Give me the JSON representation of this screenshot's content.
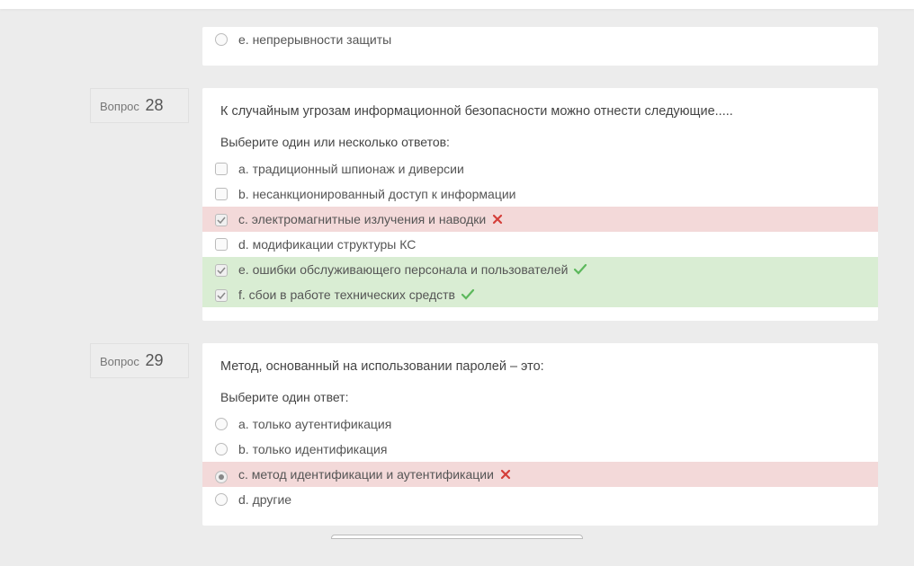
{
  "question_label": "Вопрос",
  "prompt_multi": "Выберите один или несколько ответов:",
  "prompt_single": "Выберите один ответ:",
  "questions": {
    "q_partial": {
      "answers": {
        "e": "e. непрерывности защиты"
      }
    },
    "q28": {
      "number": "28",
      "text": "К случайным угрозам информационной безопасности можно отнести следующие.....",
      "answers": {
        "a": "a. традиционный шпионаж и диверсии",
        "b": "b. несанкционированный доступ к информации",
        "c": "c. электромагнитные излучения и наводки",
        "d": "d. модификации структуры КС",
        "e": "e. ошибки обслуживающего персонала и пользователей",
        "f": "f. сбои в работе технических средств"
      }
    },
    "q29": {
      "number": "29",
      "text": "Метод, основанный на использовании паролей – это:",
      "answers": {
        "a": "a. только аутентификация",
        "b": "b. только идентификация",
        "c": "c. метод идентификации и аутентификации",
        "d": "d. другие"
      }
    }
  }
}
